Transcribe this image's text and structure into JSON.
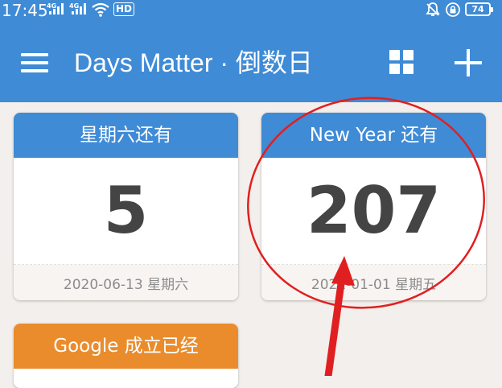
{
  "status_bar": {
    "time": "17:45",
    "network_1": "4G",
    "network_2": "4G",
    "hd_label": "HD",
    "battery": "74",
    "icons": [
      "signal-icon",
      "wifi-icon",
      "alarm-off-icon",
      "rotation-lock-icon"
    ]
  },
  "app_bar": {
    "title": "Days Matter · 倒数日",
    "background_color": "#3f8bd6",
    "icons": [
      "menu-icon",
      "grid-view-icon",
      "add-icon"
    ]
  },
  "cards": [
    {
      "title": "星期六还有",
      "count": "5",
      "date": "2020-06-13 星期六",
      "header_color": "#3f8bd6"
    },
    {
      "title": "New Year 还有",
      "count": "207",
      "date": "2021-01-01 星期五",
      "header_color": "#3f8bd6"
    },
    {
      "title": "Google 成立已经",
      "header_color": "#ea8c2c"
    }
  ],
  "annotation": {
    "color": "#e02020",
    "shapes": [
      "circle",
      "arrow"
    ]
  }
}
